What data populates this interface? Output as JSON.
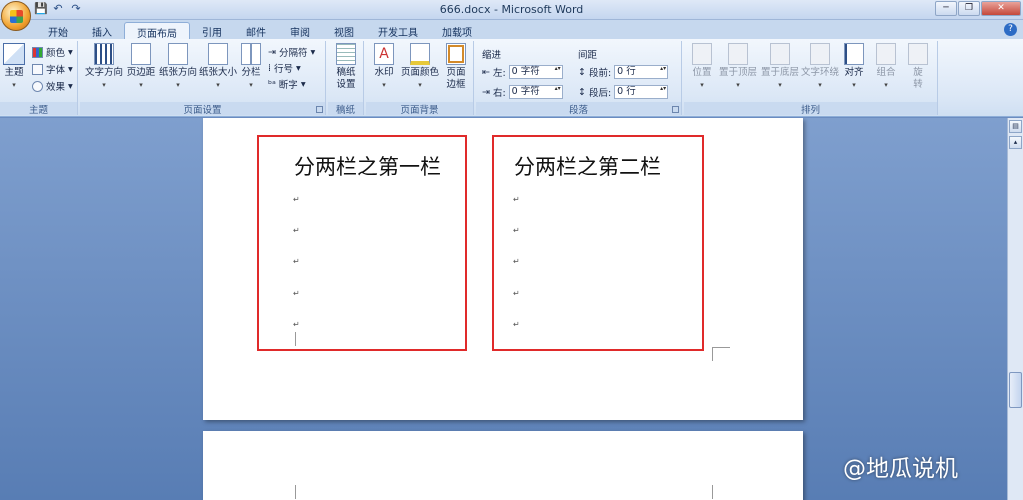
{
  "window": {
    "title": "666.docx - Microsoft Word",
    "background_docs": [
      "",
      ""
    ],
    "controls": {
      "minimize": "─",
      "restore": "❐",
      "close": "✕"
    }
  },
  "quick_access": {
    "save_icon": "💾",
    "undo_icon": "↶",
    "redo_icon": "↷"
  },
  "tabs": [
    "开始",
    "插入",
    "页面布局",
    "引用",
    "邮件",
    "审阅",
    "视图",
    "开发工具",
    "加载项"
  ],
  "active_tab": "页面布局",
  "help_icon": "?",
  "ribbon": {
    "theme_group": {
      "label": "主题",
      "theme_button": "主题",
      "colors": "颜色",
      "fonts": "字体",
      "effects": "效果"
    },
    "page_setup_group": {
      "label": "页面设置",
      "text_direction": "文字方向",
      "margins": "页边距",
      "orientation": "纸张方向",
      "size": "纸张大小",
      "columns": "分栏",
      "breaks": "分隔符",
      "line_numbers": "行号",
      "hyphenation": "断字"
    },
    "draft_group": {
      "label": "稿纸",
      "draft_setup_line1": "稿纸",
      "draft_setup_line2": "设置"
    },
    "background_group": {
      "label": "页面背景",
      "watermark": "水印",
      "page_color": "页面颜色",
      "page_border_line1": "页面",
      "page_border_line2": "边框"
    },
    "paragraph_group": {
      "label": "段落",
      "indent_title": "缩进",
      "indent_left_label": "左:",
      "indent_left_value": "0 字符",
      "indent_right_label": "右:",
      "indent_right_value": "0 字符",
      "spacing_title": "间距",
      "spacing_before_label": "段前:",
      "spacing_before_value": "0 行",
      "spacing_after_label": "段后:",
      "spacing_after_value": "0 行"
    },
    "arrange_group": {
      "label": "排列",
      "position": "位置",
      "bring_front": "置于顶层",
      "send_back": "置于底层",
      "text_wrap": "文字环绕",
      "align": "对齐",
      "group": "组合",
      "rotate_line1": "旋",
      "rotate_line2": "转"
    }
  },
  "document": {
    "column1_text": "分两栏之第一栏",
    "column2_text": "分两栏之第二栏",
    "paragraph_mark": "↵"
  },
  "watermark_text": "@地瓜说机",
  "colors": {
    "highlight_box": "#e02a2a",
    "ribbon_bg": "#dbe7f6",
    "workspace": "#6b8cc0"
  }
}
